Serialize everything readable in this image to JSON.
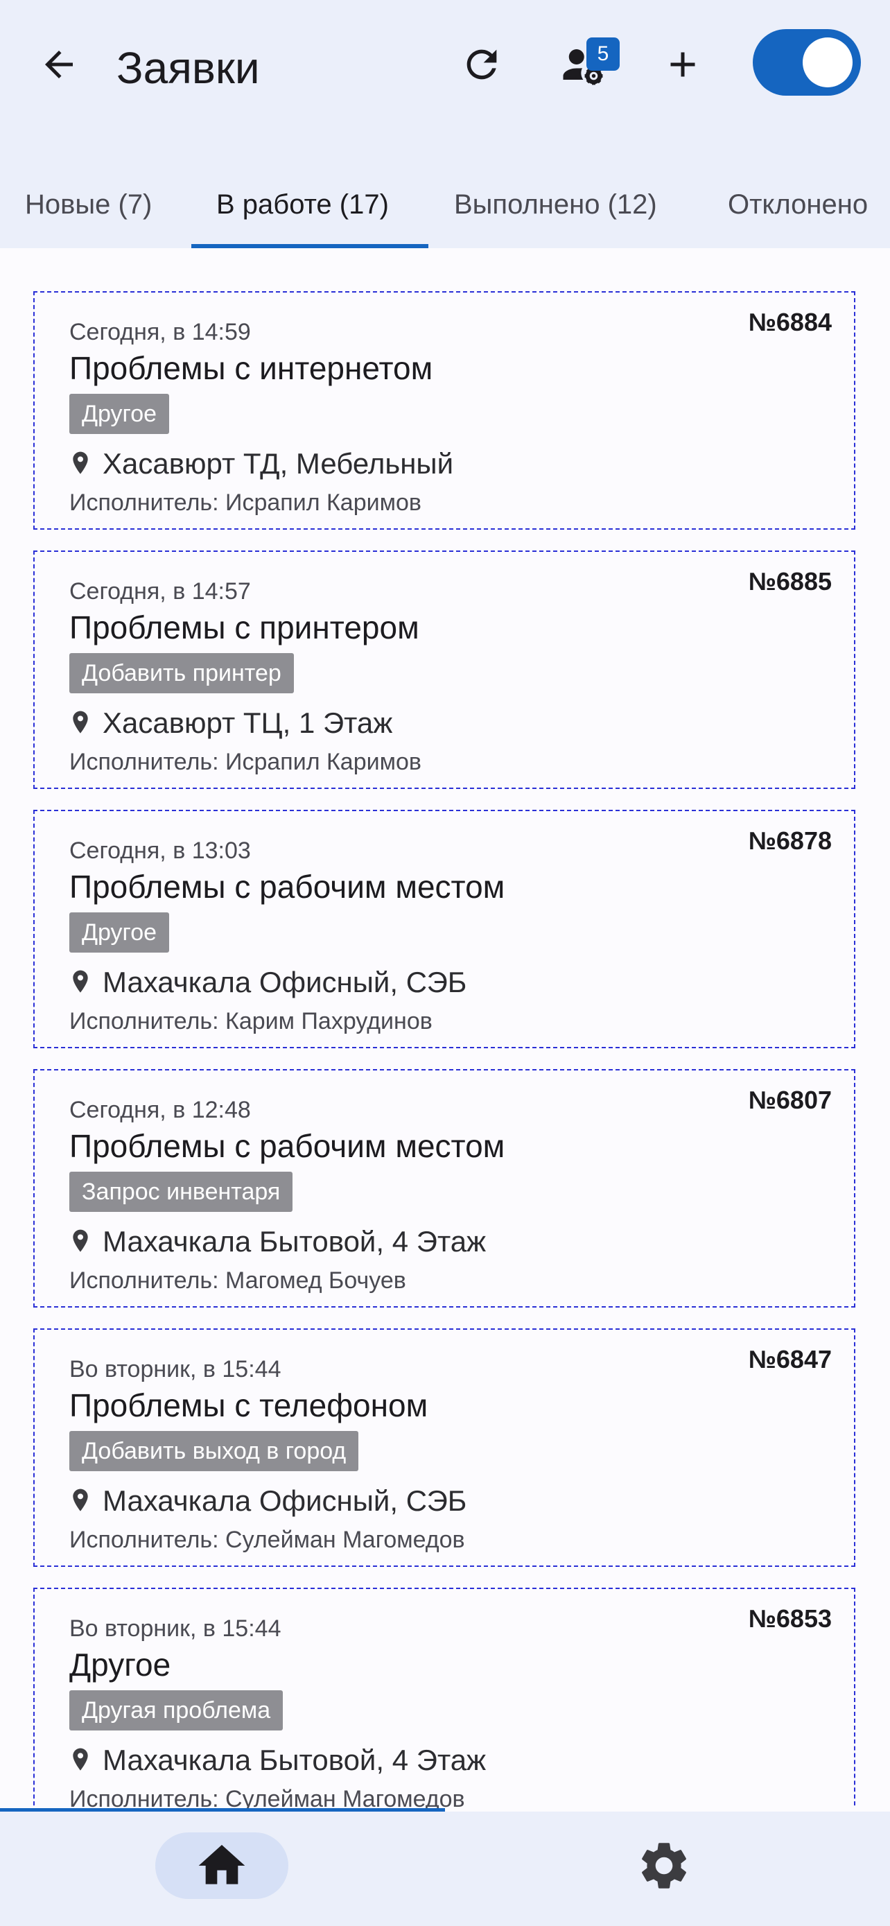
{
  "header": {
    "title": "Заявки",
    "notification_count": "5",
    "toggle_on": true
  },
  "tabs": [
    {
      "label": "Новые (7)",
      "active": false
    },
    {
      "label": "В работе (17)",
      "active": true
    },
    {
      "label": "Выполнено (12)",
      "active": false
    },
    {
      "label": "Отклонено",
      "active": false
    }
  ],
  "tickets": [
    {
      "date": "Сегодня, в 14:59",
      "number": "№6884",
      "title": "Проблемы с интернетом",
      "category": "Другое",
      "location": "Хасавюрт ТД, Мебельный",
      "executor": "Исполнитель: Исрапил Каримов"
    },
    {
      "date": "Сегодня, в 14:57",
      "number": "№6885",
      "title": "Проблемы с принтером",
      "category": "Добавить принтер",
      "location": "Хасавюрт ТЦ, 1 Этаж",
      "executor": "Исполнитель: Исрапил Каримов"
    },
    {
      "date": "Сегодня, в 13:03",
      "number": "№6878",
      "title": "Проблемы с рабочим местом",
      "category": "Другое",
      "location": "Махачкала Офисный, СЭБ",
      "executor": "Исполнитель: Карим Пахрудинов"
    },
    {
      "date": "Сегодня, в 12:48",
      "number": "№6807",
      "title": "Проблемы с рабочим местом",
      "category": "Запрос инвентаря",
      "location": "Махачкала Бытовой, 4 Этаж",
      "executor": "Исполнитель: Магомед Бочуев"
    },
    {
      "date": "Во вторник, в 15:44",
      "number": "№6847",
      "title": "Проблемы с телефоном",
      "category": "Добавить выход в город",
      "location": "Махачкала Офисный, СЭБ",
      "executor": "Исполнитель: Сулейман Магомедов"
    },
    {
      "date": "Во вторник, в 15:44",
      "number": "№6853",
      "title": "Другое",
      "category": "Другая проблема",
      "location": "Махачкала Бытовой, 4 Этаж",
      "executor": "Исполнитель: Сулейман Магомедов"
    }
  ],
  "icons": {
    "back": "arrow-back-icon",
    "refresh": "refresh-icon",
    "users": "user-settings-icon",
    "add": "plus-icon",
    "location": "location-pin-icon",
    "home": "home-icon",
    "settings": "gear-icon"
  },
  "colors": {
    "accent": "#1565c0",
    "appbar_bg": "#ebeffa",
    "card_border": "#2a2fd6",
    "chip_bg": "#8e8e93"
  }
}
